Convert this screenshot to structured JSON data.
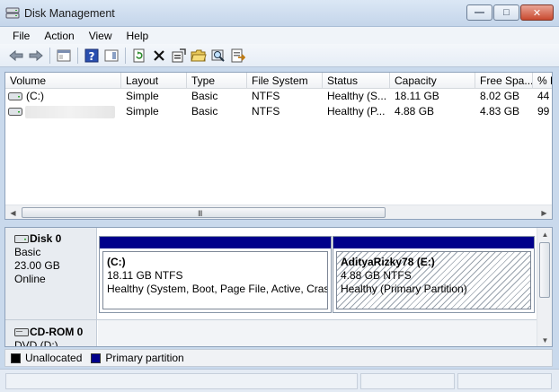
{
  "window": {
    "title": "Disk Management"
  },
  "menu": [
    "File",
    "Action",
    "View",
    "Help"
  ],
  "toolbar": {
    "icons": [
      "back-arrow-icon",
      "forward-arrow-icon",
      "console-tree-icon",
      "help-icon",
      "show-pane-icon",
      "refresh-icon",
      "delete-icon",
      "properties-icon",
      "open-folder-icon",
      "explore-icon",
      "export-icon"
    ]
  },
  "volume_list": {
    "columns": [
      "Volume",
      "Layout",
      "Type",
      "File System",
      "Status",
      "Capacity",
      "Free Spa...",
      "% F"
    ],
    "rows": [
      {
        "volume": "(C:)",
        "layout": "Simple",
        "type": "Basic",
        "file_system": "NTFS",
        "status": "Healthy (S...",
        "capacity": "18.11 GB",
        "free_space": "8.02 GB",
        "percent_free": "44"
      },
      {
        "volume": "",
        "layout": "Simple",
        "type": "Basic",
        "file_system": "NTFS",
        "status": "Healthy (P...",
        "capacity": "4.88 GB",
        "free_space": "4.83 GB",
        "percent_free": "99"
      }
    ],
    "scroll_grip": "III"
  },
  "disks": [
    {
      "name": "Disk 0",
      "kind": "Basic",
      "size": "23.00 GB",
      "state": "Online",
      "partitions": [
        {
          "label": "(C:)",
          "size_fs": "18.11 GB NTFS",
          "status": "Healthy (System, Boot, Page File, Active, Crash I",
          "style": "primary"
        },
        {
          "label": "AdityaRizky78  (E:)",
          "size_fs": "4.88 GB NTFS",
          "status": "Healthy (Primary Partition)",
          "style": "primary-selected"
        }
      ]
    },
    {
      "name": "CD-ROM 0",
      "kind": "DVD (D:)"
    }
  ],
  "legend": [
    {
      "label": "Unallocated",
      "color": "#000000"
    },
    {
      "label": "Primary partition",
      "color": "#00008b"
    }
  ],
  "colors": {
    "primary_partition": "#00008b",
    "unallocated": "#000000",
    "title_bar": "#c4d5ea"
  }
}
